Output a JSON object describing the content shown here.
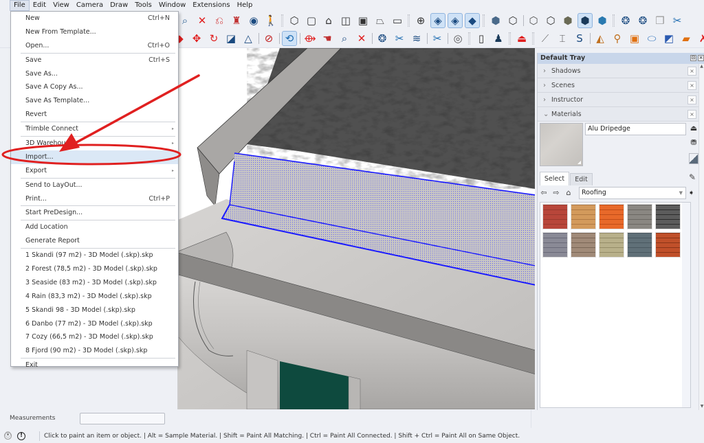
{
  "menubar": {
    "items": [
      "File",
      "Edit",
      "View",
      "Camera",
      "Draw",
      "Tools",
      "Window",
      "Extensions",
      "Help"
    ],
    "active": "File"
  },
  "file_menu": {
    "groups": [
      [
        {
          "label": "New",
          "shortcut": "Ctrl+N"
        },
        {
          "label": "New From Template...",
          "shortcut": ""
        },
        {
          "label": "Open...",
          "shortcut": "Ctrl+O"
        }
      ],
      [
        {
          "label": "Save",
          "shortcut": "Ctrl+S"
        },
        {
          "label": "Save As...",
          "shortcut": ""
        },
        {
          "label": "Save A Copy As...",
          "shortcut": ""
        },
        {
          "label": "Save As Template...",
          "shortcut": ""
        },
        {
          "label": "Revert",
          "shortcut": ""
        }
      ],
      [
        {
          "label": "Trimble Connect",
          "shortcut": "",
          "submenu": true
        }
      ],
      [
        {
          "label": "3D Warehouse",
          "shortcut": "",
          "submenu": true
        },
        {
          "label": "Import...",
          "shortcut": "",
          "highlighted": true
        },
        {
          "label": "Export",
          "shortcut": "",
          "submenu": true
        }
      ],
      [
        {
          "label": "Send to LayOut...",
          "shortcut": ""
        },
        {
          "label": "Print...",
          "shortcut": "Ctrl+P"
        }
      ],
      [
        {
          "label": "Start PreDesign...",
          "shortcut": ""
        }
      ],
      [
        {
          "label": "Add Location",
          "shortcut": ""
        },
        {
          "label": "Generate Report",
          "shortcut": ""
        }
      ],
      [
        {
          "label": "1 Skandi (97 m2) - 3D Model (.skp).skp",
          "shortcut": ""
        },
        {
          "label": "2 Forest (78,5 m2) - 3D Model (.skp).skp",
          "shortcut": ""
        },
        {
          "label": "3 Seaside (83 m2) - 3D Model (.skp).skp",
          "shortcut": ""
        },
        {
          "label": "4 Rain (83,3 m2) - 3D Model (.skp).skp",
          "shortcut": ""
        },
        {
          "label": "5 Skandi 98 - 3D Model (.skp).skp",
          "shortcut": ""
        },
        {
          "label": "6 Danbo (77 m2) - 3D Model (.skp).skp",
          "shortcut": ""
        },
        {
          "label": "7 Cozy (66,5 m2) - 3D Model (.skp).skp",
          "shortcut": ""
        },
        {
          "label": "8 Fjord (90 m2) - 3D Model (.skp).skp",
          "shortcut": ""
        }
      ],
      [
        {
          "label": "Exit",
          "shortcut": ""
        }
      ]
    ],
    "submenu_arrow": "▸"
  },
  "toolbar1": {
    "icons": [
      {
        "name": "zoom-window-icon",
        "glyph": "⌕",
        "color": "#2a5d8f"
      },
      {
        "name": "zoom-extents-icon",
        "glyph": "✕",
        "color": "#e02020"
      },
      {
        "name": "previous-view-icon",
        "glyph": "⎌",
        "color": "#d03030"
      },
      {
        "name": "position-camera-icon",
        "glyph": "♜",
        "color": "#c03030"
      },
      {
        "name": "look-around-icon",
        "glyph": "◉",
        "color": "#1a4a80"
      },
      {
        "name": "walk-icon",
        "glyph": "🚶",
        "color": "#333"
      },
      {
        "name": "iso-view-icon",
        "glyph": "⬡",
        "color": "#333"
      },
      {
        "name": "top-view-icon",
        "glyph": "▢",
        "color": "#333"
      },
      {
        "name": "front-view-icon",
        "glyph": "⌂",
        "color": "#333"
      },
      {
        "name": "right-view-icon",
        "glyph": "◫",
        "color": "#333"
      },
      {
        "name": "back-view-icon",
        "glyph": "▣",
        "color": "#333"
      },
      {
        "name": "left-view-icon",
        "glyph": "⏢",
        "color": "#333"
      },
      {
        "name": "bottom-view-icon",
        "glyph": "▭",
        "color": "#333"
      },
      {
        "name": "xray-section-icon",
        "glyph": "⊕",
        "color": "#333"
      },
      {
        "name": "section-plane-icon",
        "glyph": "◈",
        "color": "#1a4a80",
        "pressed": true
      },
      {
        "name": "display-section-cuts-icon",
        "glyph": "◈",
        "color": "#1a4a80",
        "pressed": true
      },
      {
        "name": "display-section-fill-icon",
        "glyph": "◆",
        "color": "#1a4a80",
        "pressed": true
      },
      {
        "name": "xray-icon",
        "glyph": "⬢",
        "color": "#4a6a8a"
      },
      {
        "name": "back-edges-icon",
        "glyph": "⬡",
        "color": "#333"
      },
      {
        "name": "wireframe-icon",
        "glyph": "⬡",
        "color": "#555"
      },
      {
        "name": "hidden-line-icon",
        "glyph": "⬡",
        "color": "#333"
      },
      {
        "name": "shaded-icon",
        "glyph": "⬢",
        "color": "#6a6a55"
      },
      {
        "name": "shaded-with-textures-icon",
        "glyph": "⬢",
        "color": "#1a3a5a",
        "pressed": true
      },
      {
        "name": "monochrome-icon",
        "glyph": "⬢",
        "color": "#2a7ab0"
      },
      {
        "name": "get-models-icon",
        "glyph": "❂",
        "color": "#1a4a80"
      },
      {
        "name": "share-model-icon",
        "glyph": "❂",
        "color": "#1a4a80"
      },
      {
        "name": "share-component-icon",
        "glyph": "❒",
        "color": "#999"
      },
      {
        "name": "extension-warehouse-icon",
        "glyph": "✂",
        "color": "#1a6ab0"
      }
    ]
  },
  "toolbar2": {
    "icons": [
      {
        "name": "push-pull-icon",
        "glyph": "◆",
        "color": "#e02020"
      },
      {
        "name": "move-icon",
        "glyph": "✥",
        "color": "#e02020"
      },
      {
        "name": "rotate-icon",
        "glyph": "↻",
        "color": "#e02020"
      },
      {
        "name": "scale-icon",
        "glyph": "◪",
        "color": "#1a4a80"
      },
      {
        "name": "flip-icon",
        "glyph": "△",
        "color": "#1a4a80"
      },
      {
        "name": "tape-measure-icon",
        "glyph": "⊘",
        "color": "#c02020"
      },
      {
        "name": "paint-bucket-icon",
        "glyph": "⟲",
        "color": "#1a6ab0",
        "pressed": true
      },
      {
        "name": "orbit-icon",
        "glyph": "⟴",
        "color": "#e02020"
      },
      {
        "name": "pan-icon",
        "glyph": "☚",
        "color": "#c03030"
      },
      {
        "name": "zoom-icon",
        "glyph": "⌕",
        "color": "#1a4a80"
      },
      {
        "name": "zoom-extents-2-icon",
        "glyph": "✕",
        "color": "#e02020"
      },
      {
        "name": "warehouse-download-icon",
        "glyph": "❂",
        "color": "#1a4a80"
      },
      {
        "name": "extension-manager-icon",
        "glyph": "✂",
        "color": "#1a6ab0"
      },
      {
        "name": "layers-share-icon",
        "glyph": "≋",
        "color": "#1a4a80"
      },
      {
        "name": "extension-settings-icon",
        "glyph": "✂",
        "color": "#1a6ab0"
      },
      {
        "name": "account-icon",
        "glyph": "◎",
        "color": "#555"
      },
      {
        "name": "new-document-icon",
        "glyph": "▯",
        "color": "#333"
      },
      {
        "name": "add-user-icon",
        "glyph": "♟",
        "color": "#1a3a5a"
      },
      {
        "name": "perspective-frame-icon",
        "glyph": "⏏",
        "color": "#e02020"
      },
      {
        "name": "dripedge-tool-icon",
        "glyph": "⟋",
        "color": "#777"
      },
      {
        "name": "dimension-tool-icon",
        "glyph": "⌶",
        "color": "#555"
      },
      {
        "name": "profile-tool-icon",
        "glyph": "S",
        "color": "#1a4a80"
      },
      {
        "name": "shingle-tool-icon",
        "glyph": "◭",
        "color": "#c07020"
      },
      {
        "name": "hierarchy-tool-icon",
        "glyph": "⚲",
        "color": "#c07020"
      },
      {
        "name": "frame-tool-icon",
        "glyph": "▣",
        "color": "#e07010"
      },
      {
        "name": "cylinder-tool-icon",
        "glyph": "⬭",
        "color": "#3a7ac0"
      },
      {
        "name": "image-tool-icon",
        "glyph": "◩",
        "color": "#2a5ab0"
      },
      {
        "name": "flag-tool-icon",
        "glyph": "▰",
        "color": "#e07010"
      },
      {
        "name": "erase-tool-icon",
        "glyph": "✗",
        "color": "#e02020"
      }
    ]
  },
  "tray": {
    "title": "Default Tray",
    "pin_glyph": "⊡",
    "close_glyph": "×",
    "panels": [
      {
        "label": "Shadows",
        "expanded": false
      },
      {
        "label": "Scenes",
        "expanded": false
      },
      {
        "label": "Instructor",
        "expanded": false
      },
      {
        "label": "Materials",
        "expanded": true
      }
    ],
    "collapsed_chevron": "›",
    "expanded_chevron": "⌄",
    "panel_close_glyph": "×",
    "materials": {
      "current_name": "Alu Dripedge",
      "tabs": [
        "Select",
        "Edit"
      ],
      "active_tab": "Select",
      "library": "Roofing",
      "nav": {
        "back": "⇦",
        "forward": "⇨",
        "home": "⌂"
      },
      "swatches": [
        {
          "name": "swatch-red-metal-roof",
          "color": "#b8463a",
          "accent": "#9a3a2f"
        },
        {
          "name": "swatch-wood-scale-shingles",
          "color": "#d39a5c",
          "accent": "#b07a44"
        },
        {
          "name": "swatch-orange-diamond-tiles",
          "color": "#e8692a",
          "accent": "#c04d18"
        },
        {
          "name": "swatch-gray-slate-rows",
          "color": "#8a8782",
          "accent": "#6b6863"
        },
        {
          "name": "swatch-dark-scale-slate",
          "color": "#5c5c5c",
          "accent": "#2c2c2c"
        },
        {
          "name": "swatch-gray-blue-shingles",
          "color": "#8a8a96",
          "accent": "#6a6a78"
        },
        {
          "name": "swatch-brown-asphalt-shingles",
          "color": "#a08a78",
          "accent": "#7a6656"
        },
        {
          "name": "swatch-olive-shingles",
          "color": "#b8b08a",
          "accent": "#948c68"
        },
        {
          "name": "swatch-blue-gray-slate",
          "color": "#607078",
          "accent": "#4a5860"
        },
        {
          "name": "swatch-terracotta-tiles",
          "color": "#c0502a",
          "accent": "#8a3418"
        }
      ]
    }
  },
  "measurements": {
    "label": "Measurements",
    "value": ""
  },
  "statusbar": {
    "text": "Click to paint an item or object. | Alt = Sample Material. | Shift = Paint All Matching. | Ctrl = Paint All Connected. | Shift + Ctrl = Paint All on Same Object."
  },
  "annotation": {
    "color": "#e02020",
    "target": "Import..."
  },
  "viewport": {
    "selection_color": "#1a1aff",
    "door_color": "#0e4a3e"
  }
}
